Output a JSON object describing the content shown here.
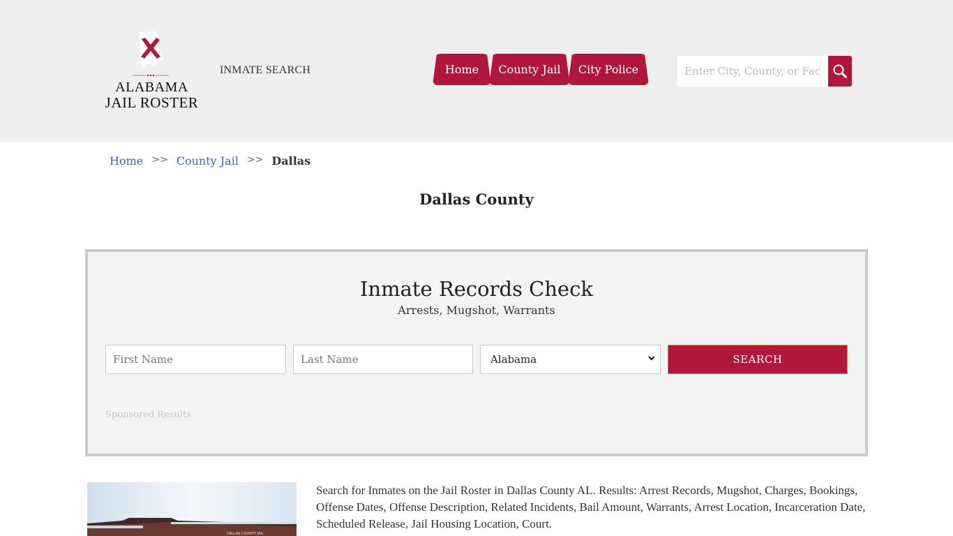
{
  "header": {
    "logo": {
      "line1": "ALABAMA",
      "line2": "JAIL ROSTER",
      "icon": "alabama-state-flag-map"
    },
    "inmate_search_link": "INMATE SEARCH",
    "nav": [
      {
        "label": "Home"
      },
      {
        "label": "County Jail"
      },
      {
        "label": "City Police"
      }
    ],
    "search": {
      "placeholder": "Enter City, County, or Facility",
      "button_icon": "search-icon"
    }
  },
  "breadcrumb": {
    "items": [
      {
        "label": "Home"
      },
      {
        "label": "County Jail"
      },
      {
        "label": "Dallas"
      }
    ],
    "separator": ">>"
  },
  "page_title": "Dallas County",
  "records_check": {
    "title": "Inmate Records Check",
    "subtitle": "Arrests, Mugshot, Warrants",
    "first_name_placeholder": "First Name",
    "last_name_placeholder": "Last Name",
    "state_selected": "Alabama",
    "search_button": "SEARCH",
    "sponsored_label": "Sponsored Results"
  },
  "content": {
    "photo_caption": "DALLAS COUNTY JAIL",
    "description": "Search for Inmates on the Jail Roster in Dallas County AL. Results: Arrest Records, Mugshot, Charges, Bookings, Offense Dates, Offense Description, Related Incidents, Bail Amount, Warrants, Arrest Location, Incarceration Date, Scheduled Release, Jail Housing Location, Court."
  },
  "colors": {
    "brand": "#b0173b",
    "header_bg": "#efefef",
    "link": "#3c64c8",
    "box_bg": "#f4f4f4",
    "box_border": "#cbcbcb"
  }
}
